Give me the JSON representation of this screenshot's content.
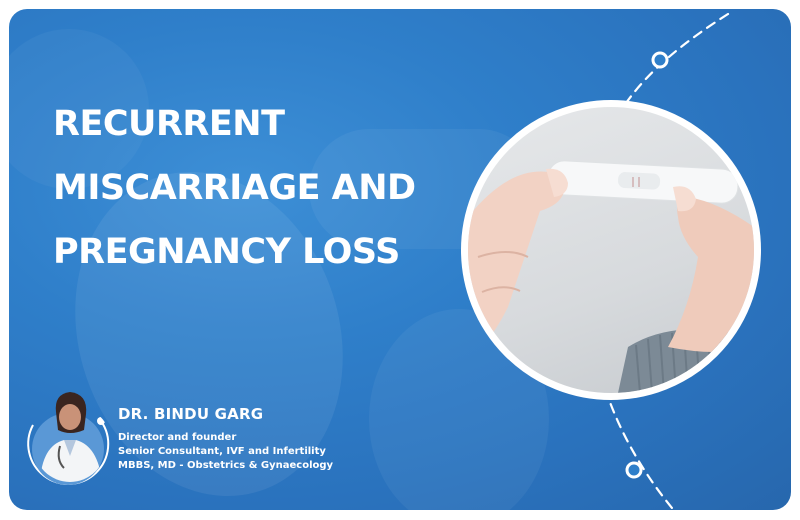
{
  "title_lines": [
    "RECURRENT",
    "MISCARRIAGE AND",
    "PREGNANCY LOSS"
  ],
  "doctor": {
    "name": "DR. BINDU GARG",
    "credentials": [
      "Director and founder",
      "Senior Consultant, IVF and Infertility",
      "MBBS, MD - Obstetrics & Gynaecology"
    ]
  },
  "colors": {
    "background": "#2f7fca",
    "text": "#ffffff"
  },
  "images": {
    "hero": "hands-holding-pregnancy-test-photo",
    "avatar": "doctor-portrait-photo"
  }
}
